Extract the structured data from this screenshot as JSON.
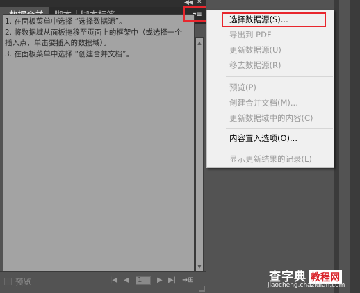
{
  "panel": {
    "tabs": [
      {
        "label": "数据合并",
        "active": true
      },
      {
        "label": "脚本",
        "active": false
      },
      {
        "label": "脚本标签",
        "active": false
      }
    ],
    "instructions": [
      "1. 在面板菜单中选择 “选择数据源”。",
      "2. 将数据域从面板拖移至页面上的框架中（或选择一个",
      "插入点，单击要插入的数据域）。",
      "3. 在面板菜单中选择 “创建合并文档”。"
    ],
    "bottom": {
      "preview_label": "预览",
      "page_number": "1"
    }
  },
  "menu": {
    "items": [
      {
        "label": "选择数据源(S)...",
        "enabled": true,
        "highlighted": true
      },
      {
        "label": "导出到 PDF",
        "enabled": false
      },
      {
        "label": "更新数据源(U)",
        "enabled": false
      },
      {
        "label": "移去数据源(R)",
        "enabled": false
      },
      {
        "label": "预览(P)",
        "enabled": false
      },
      {
        "label": "创建合并文档(M)...",
        "enabled": false
      },
      {
        "label": "更新数据域中的内容(C)",
        "enabled": false
      },
      {
        "label": "内容置入选项(O)...",
        "enabled": true
      },
      {
        "label": "显示更新结果的记录(L)",
        "enabled": false
      }
    ]
  },
  "watermark": {
    "title": "查字典",
    "tag": "教程网",
    "url": "jiaocheng.chazidian.com"
  },
  "colors": {
    "highlight_box": "#e8262d",
    "panel_bg": "#535353",
    "text_area_bg": "#a3a3a3",
    "menu_bg": "#f0f0f0"
  },
  "icons": {
    "collapse": "double-chevron-left-icon",
    "close": "close-icon",
    "panel_menu": "panel-menu-icon",
    "nav_first": "first-page-icon",
    "nav_prev": "previous-page-icon",
    "nav_next": "next-page-icon",
    "nav_last": "last-page-icon",
    "export": "export-icon"
  }
}
